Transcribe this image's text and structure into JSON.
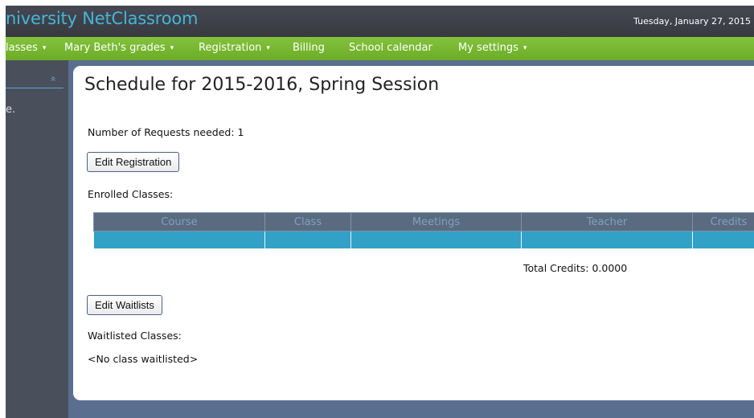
{
  "header": {
    "app_title": "niversity NetClassroom",
    "date": "Tuesday, January 27, 2015"
  },
  "menu": {
    "items": [
      {
        "label": "lasses",
        "has_dropdown": true
      },
      {
        "label": "Mary Beth's grades",
        "has_dropdown": true
      },
      {
        "label": "Registration",
        "has_dropdown": true
      },
      {
        "label": "Billing",
        "has_dropdown": false
      },
      {
        "label": "School calendar",
        "has_dropdown": false
      },
      {
        "label": "My settings",
        "has_dropdown": true
      }
    ],
    "caret": "▾"
  },
  "sidebar": {
    "collapse_icon": "double-chevron-up-icon",
    "collapse_glyph": "«",
    "text": "e."
  },
  "main": {
    "title": "Schedule for 2015-2016, Spring Session",
    "requests_label": "Number of Requests needed: 1",
    "edit_registration_label": "Edit Registration",
    "enrolled_label": "Enrolled Classes:",
    "table": {
      "headers": [
        "Course",
        "Class",
        "Meetings",
        "Teacher",
        "Credits"
      ]
    },
    "total_credits": "Total Credits: 0.0000",
    "edit_waitlists_label": "Edit Waitlists",
    "waitlisted_label": "Waitlisted Classes:",
    "no_waitlist": "<No class waitlisted>"
  },
  "colors": {
    "accent_blue": "#44b6d6",
    "menu_green": "#7ab832",
    "table_row": "#33a0c6",
    "frame_bg": "#5a6f8f"
  }
}
